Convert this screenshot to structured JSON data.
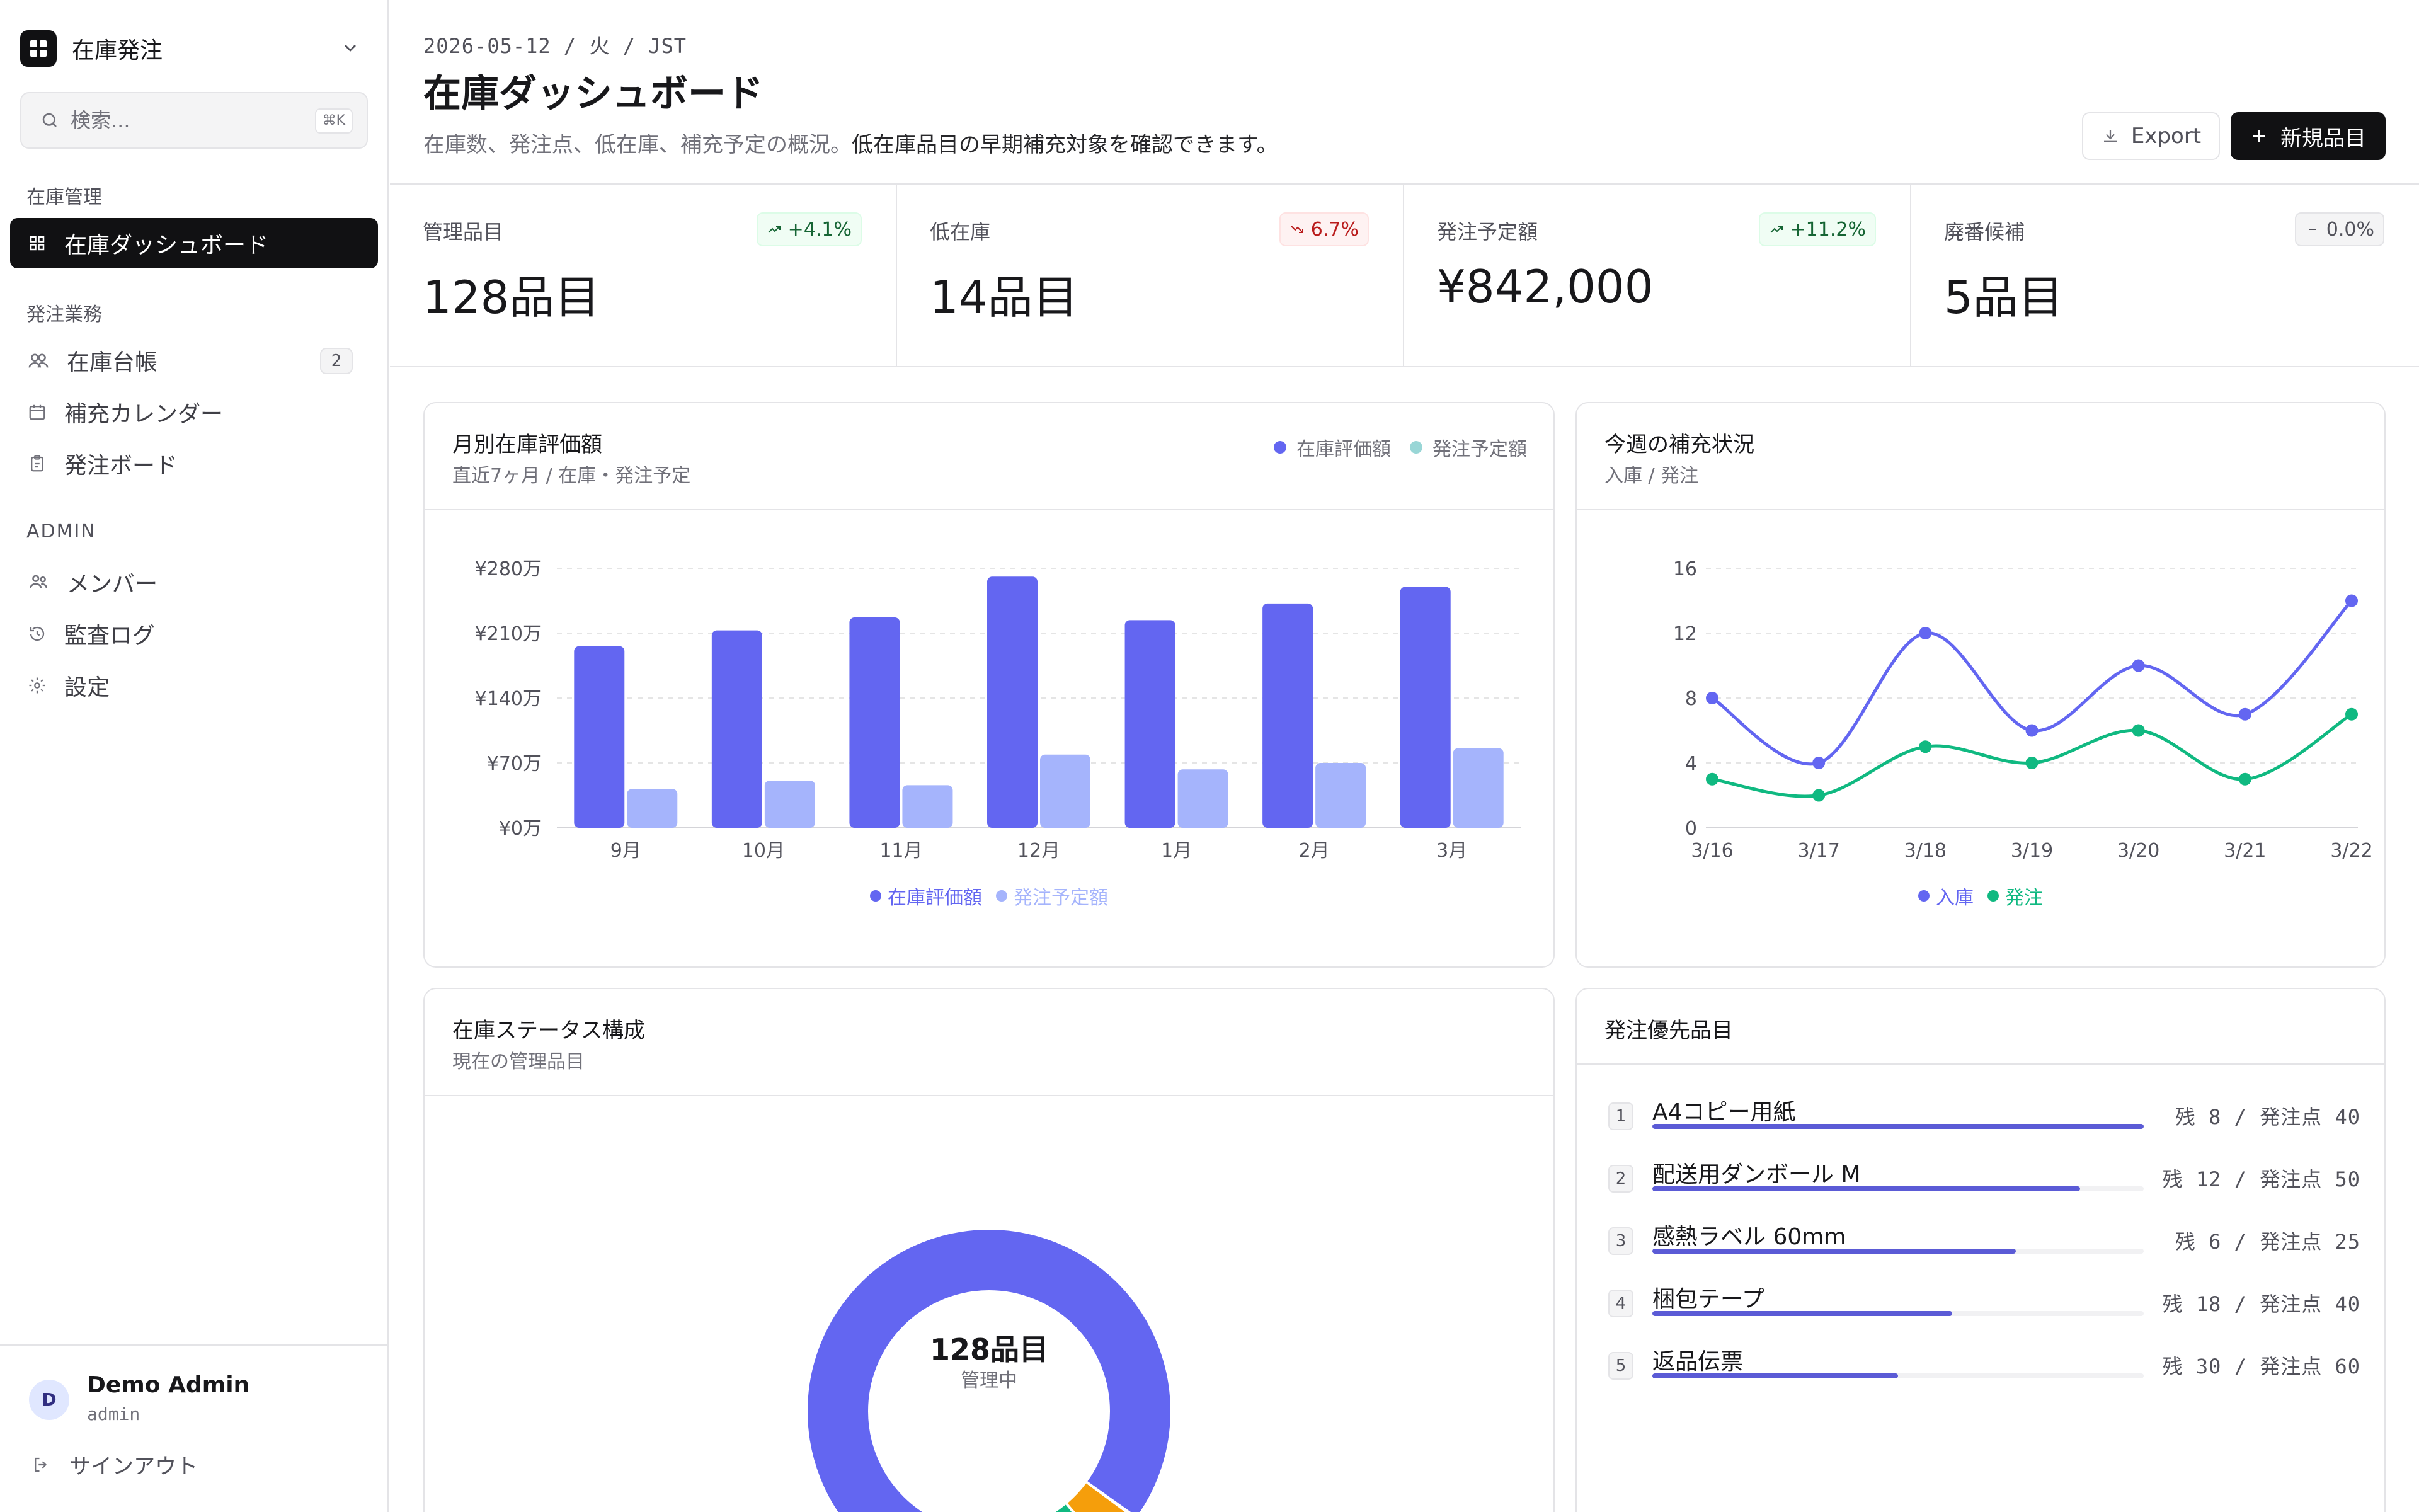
{
  "sidebar": {
    "workspace": "在庫発注",
    "search_placeholder": "検索...",
    "search_shortcut": "⌘K",
    "groups": [
      {
        "label": "在庫管理",
        "items": [
          {
            "label": "在庫ダッシュボード",
            "icon": "grid-icon",
            "active": true
          }
        ]
      },
      {
        "label": "発注業務",
        "items": [
          {
            "label": "在庫台帳",
            "icon": "users-icon",
            "badge": "2"
          },
          {
            "label": "補充カレンダー",
            "icon": "calendar-icon"
          },
          {
            "label": "発注ボード",
            "icon": "clipboard-icon"
          }
        ]
      },
      {
        "label": "ADMIN",
        "items": [
          {
            "label": "メンバー",
            "icon": "members-icon"
          },
          {
            "label": "監査ログ",
            "icon": "history-icon"
          },
          {
            "label": "設定",
            "icon": "gear-icon"
          }
        ]
      }
    ],
    "user": {
      "initial": "D",
      "name": "Demo Admin",
      "role": "admin"
    },
    "signout": "サインアウト"
  },
  "header": {
    "date": "2026-05-12 / 火 / JST",
    "title": "在庫ダッシュボード",
    "desc_muted": "在庫数、発注点、低在庫、補充予定の概況。",
    "desc_strong": "低在庫品目の早期補充対象を確認できます。",
    "export_label": "Export",
    "new_label": "新規品目"
  },
  "kpis": [
    {
      "label": "管理品目",
      "value": "128品目",
      "delta": "+4.1%",
      "trend": "up"
    },
    {
      "label": "低在庫",
      "value": "14品目",
      "delta": "6.7%",
      "trend": "down"
    },
    {
      "label": "発注予定額",
      "value": "¥842,000",
      "delta": "+11.2%",
      "trend": "up"
    },
    {
      "label": "廃番候補",
      "value": "5品目",
      "delta": "0.0%",
      "trend": "flat"
    }
  ],
  "colors": {
    "primary": "#6366f1",
    "secondary": "#a5b4fc",
    "green": "#10b981",
    "amber": "#f59e0b",
    "teal_legend": "#99d6d6"
  },
  "bar_card": {
    "title": "月別在庫評価額",
    "subtitle": "直近7ヶ月 / 在庫・発注予定",
    "legend_top": [
      "在庫評価額",
      "発注予定額"
    ]
  },
  "line_card": {
    "title": "今週の補充状況",
    "subtitle": "入庫 / 発注"
  },
  "donut_card": {
    "title": "在庫ステータス構成",
    "subtitle": "現在の管理品目",
    "center_value": "128品目",
    "center_label": "管理中"
  },
  "priority_card": {
    "title": "発注優先品目",
    "items": [
      {
        "rank": "1",
        "name": "A4コピー用紙",
        "stock_text": "残 8 / 発注点 40",
        "fill": 1.0
      },
      {
        "rank": "2",
        "name": "配送用ダンボール M",
        "stock_text": "残 12 / 発注点 50",
        "fill": 0.87
      },
      {
        "rank": "3",
        "name": "感熱ラベル 60mm",
        "stock_text": "残 6 / 発注点 25",
        "fill": 0.74
      },
      {
        "rank": "4",
        "name": "梱包テープ",
        "stock_text": "残 18 / 発注点 40",
        "fill": 0.61
      },
      {
        "rank": "5",
        "name": "返品伝票",
        "stock_text": "残 30 / 発注点 60",
        "fill": 0.5
      }
    ]
  },
  "chart_data": [
    {
      "type": "bar",
      "categories": [
        "9月",
        "10月",
        "11月",
        "12月",
        "1月",
        "2月",
        "3月"
      ],
      "series": [
        {
          "name": "在庫評価額",
          "values": [
            196,
            213,
            227,
            271,
            224,
            242,
            260
          ]
        },
        {
          "name": "発注予定額",
          "values": [
            42,
            51,
            46,
            79,
            63,
            70,
            86
          ]
        }
      ],
      "yticks": [
        "¥0万",
        "¥70万",
        "¥140万",
        "¥210万",
        "¥280万"
      ],
      "ylim": [
        0,
        280
      ],
      "legend": "bottom"
    },
    {
      "type": "line",
      "x": [
        "3/16",
        "3/17",
        "3/18",
        "3/19",
        "3/20",
        "3/21",
        "3/22"
      ],
      "series": [
        {
          "name": "入庫",
          "values": [
            8,
            4,
            12,
            6,
            10,
            7,
            14
          ]
        },
        {
          "name": "発注",
          "values": [
            3,
            2,
            5,
            4,
            6,
            3,
            7
          ]
        }
      ],
      "yticks": [
        "0",
        "4",
        "8",
        "12",
        "16"
      ],
      "ylim": [
        0,
        16
      ],
      "legend": "bottom"
    },
    {
      "type": "pie",
      "values": [
        109,
        5,
        14
      ],
      "colors": [
        "#6366f1",
        "#f59e0b",
        "#10b981"
      ]
    }
  ]
}
